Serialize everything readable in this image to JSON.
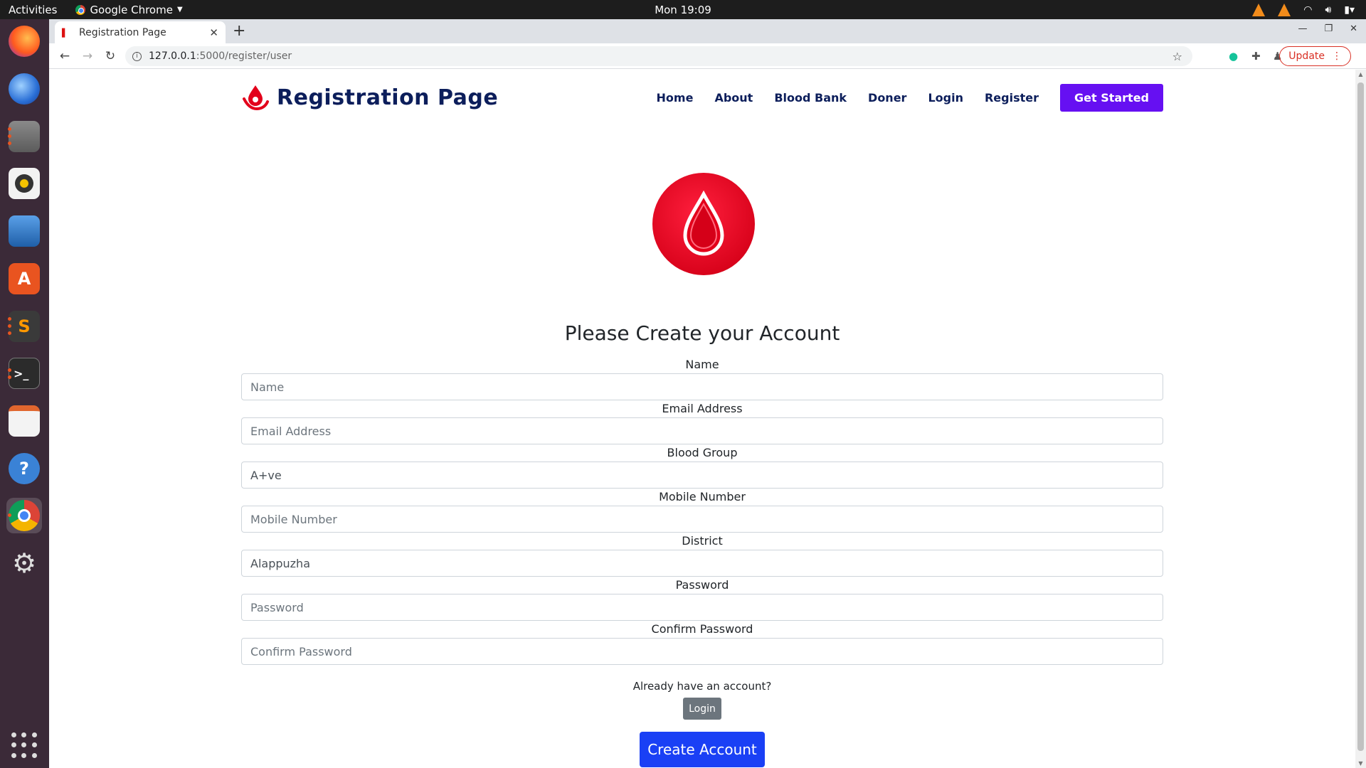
{
  "system": {
    "activities": "Activities",
    "app_name": "Google Chrome",
    "clock": "Mon 19:09"
  },
  "browser": {
    "tab_title": "Registration Page",
    "url_host": "127.0.0.1",
    "url_path": ":5000/register/user",
    "update_label": "Update"
  },
  "navbar": {
    "brand": "Registration Page",
    "links": [
      "Home",
      "About",
      "Blood Bank",
      "Doner",
      "Login",
      "Register"
    ],
    "cta": "Get Started"
  },
  "form": {
    "heading": "Please Create your Account",
    "fields": [
      {
        "label": "Name",
        "placeholder": "Name",
        "value": ""
      },
      {
        "label": "Email Address",
        "placeholder": "Email Address",
        "value": ""
      },
      {
        "label": "Blood Group",
        "placeholder": "",
        "value": "A+ve"
      },
      {
        "label": "Mobile Number",
        "placeholder": "Mobile Number",
        "value": ""
      },
      {
        "label": "District",
        "placeholder": "",
        "value": "Alappuzha"
      },
      {
        "label": "Password",
        "placeholder": "Password",
        "value": ""
      },
      {
        "label": "Confirm Password",
        "placeholder": "Confirm Password",
        "value": ""
      }
    ],
    "already_text": "Already have an account?",
    "login_button": "Login",
    "create_button": "Create Account"
  },
  "colors": {
    "brand_navy": "#0c1e5b",
    "cta_purple": "#6610f2",
    "create_blue": "#1a40f5",
    "blood_red": "#e3001b"
  }
}
